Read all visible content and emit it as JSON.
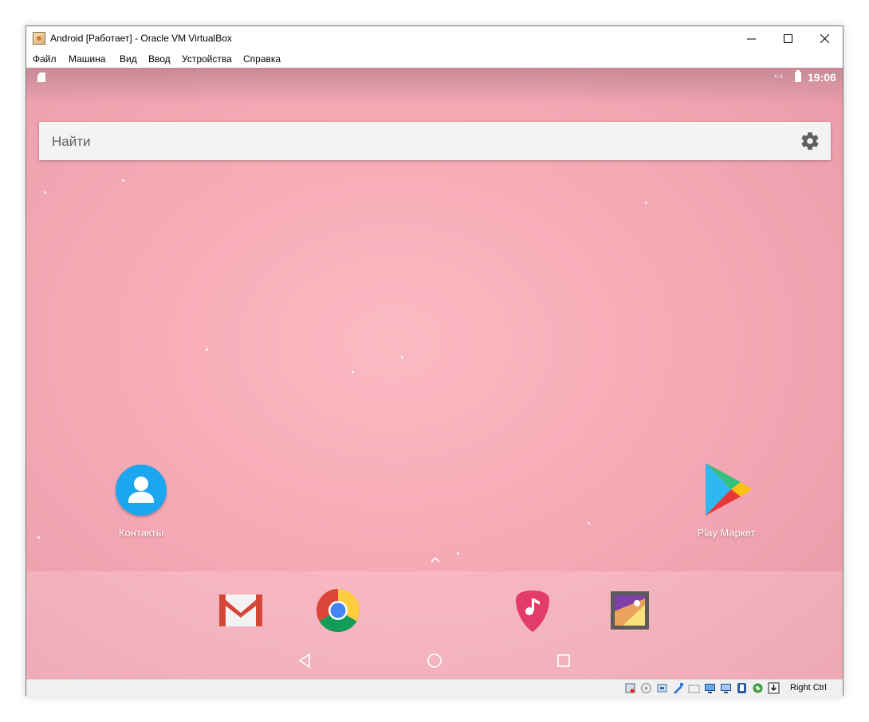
{
  "window": {
    "title": "Android [Работает] - Oracle VM VirtualBox",
    "app_icon": "virtualbox-icon"
  },
  "menu": {
    "items": [
      {
        "label": "Файл"
      },
      {
        "label": "Машина"
      },
      {
        "label": "Вид"
      },
      {
        "label": "Ввод"
      },
      {
        "label": "Устройства"
      },
      {
        "label": "Справка"
      }
    ]
  },
  "android": {
    "status": {
      "network": "‹·›",
      "time": "19:06"
    },
    "search": {
      "placeholder": "Найти"
    },
    "desktop_apps": [
      {
        "label": "Контакты",
        "icon": "contacts-icon"
      },
      {
        "label": "Play Маркет",
        "icon": "play-store-icon"
      }
    ],
    "dock_apps": [
      {
        "icon": "gmail-icon"
      },
      {
        "icon": "chrome-icon"
      },
      {
        "icon": "music-icon"
      },
      {
        "icon": "gallery-icon"
      }
    ],
    "nav": [
      "back",
      "home",
      "recents"
    ]
  },
  "vbox_status": {
    "host_key": "Right Ctrl"
  }
}
